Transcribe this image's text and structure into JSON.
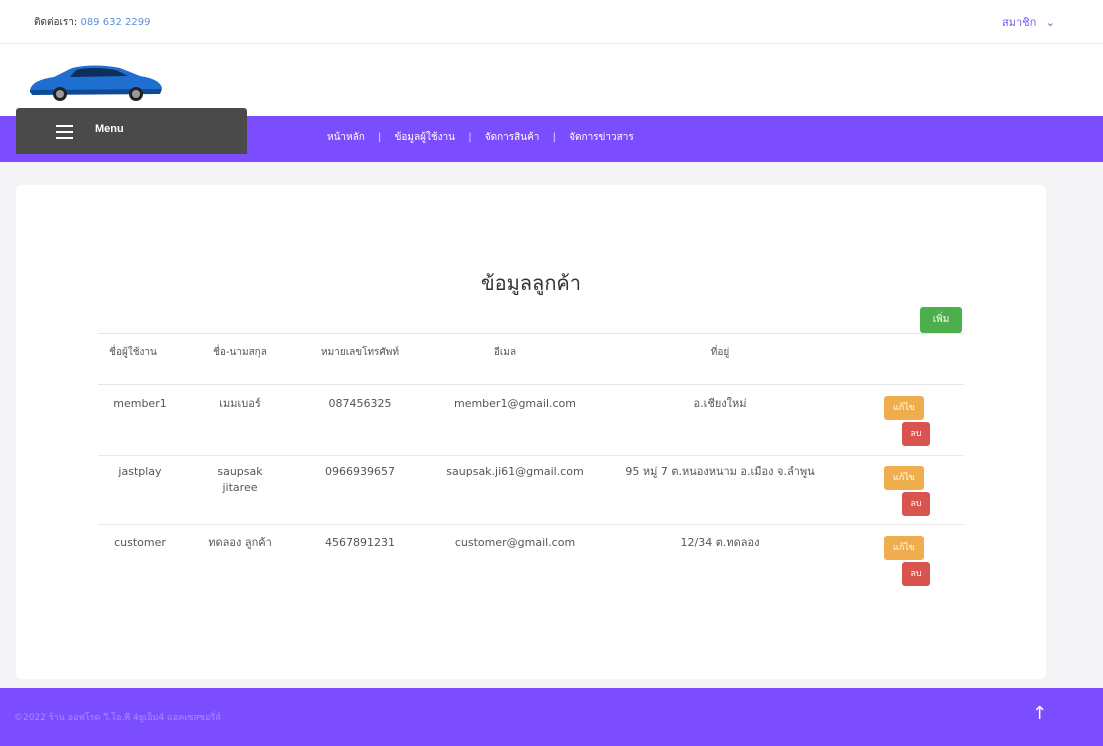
{
  "topbar": {
    "contact_label": "ติดต่อเรา:",
    "contact_phone": "089 632 2299",
    "member_menu": "สมาชิก",
    "member_chevron": "⌄"
  },
  "menu": {
    "label": "Menu",
    "icon": "hamburger-icon"
  },
  "nav": {
    "items": [
      "หน้าหลัก",
      "ข้อมูลผู้ใช้งาน",
      "จัดการสินค้า",
      "จัดการข่าวสาร"
    ],
    "separator": "|"
  },
  "page": {
    "title": "ข้อมูลลูกค้า",
    "add_button": "เพิ่ม"
  },
  "table": {
    "headers": [
      "ชื่อผู้ใช้งาน",
      "ชื่อ-นามสกุล",
      "หมายเลขโทรศัพท์",
      "อีเมล",
      "ที่อยู่"
    ],
    "rows": [
      {
        "username": "member1",
        "fullname": "เมมเบอร์",
        "phone": "087456325",
        "email": "member1@gmail.com",
        "address": "อ.เชียงใหม่",
        "edit": "แก้ไข",
        "delete": "ลบ"
      },
      {
        "username": "jastplay",
        "fullname": "saupsak jitaree",
        "phone": "0966939657",
        "email": "saupsak.ji61@gmail.com",
        "address": "95 หมู่ 7 ต.หนองหนาม อ.เมือง จ.ลำพูน",
        "edit": "แก้ไข",
        "delete": "ลบ"
      },
      {
        "username": "customer",
        "fullname": "ทดลอง ลูกค้า",
        "phone": "4567891231",
        "email": "customer@gmail.com",
        "address": "12/34 ต.ทดลอง",
        "edit": "แก้ไข",
        "delete": "ลบ"
      }
    ]
  },
  "footer": {
    "copyright": "©2022 ร้าน ออฟโรด วี.โอ.พี 4ยูเอ็ม4 แอคเซสซอรี่ส์",
    "back_to_top": "↑"
  },
  "colors": {
    "brand_purple": "#7c4dff",
    "menu_dark": "#4a4a4a",
    "add_green": "#4cae4c",
    "edit_orange": "#f0ad4e",
    "delete_red": "#d9534f"
  }
}
